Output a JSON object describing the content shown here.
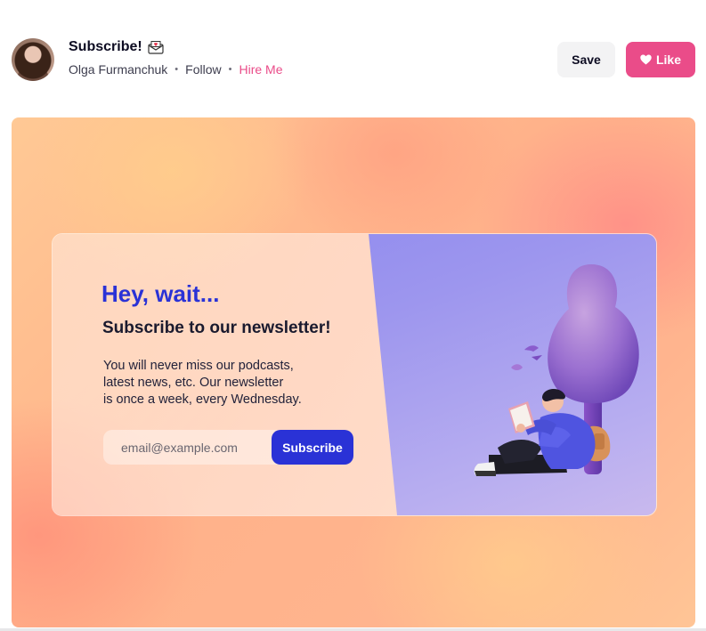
{
  "header": {
    "title": "Subscribe!",
    "title_icon": "envelope-icon",
    "author": "Olga Furmanchuk",
    "follow": "Follow",
    "hire": "Hire Me",
    "separator": "•",
    "save_label": "Save",
    "like_label": "Like",
    "like_icon": "heart-icon",
    "accent_color": "#ea4c89"
  },
  "shot": {
    "headline": "Hey, wait...",
    "subhead": "Subscribe to our newsletter!",
    "description_lines": [
      "You will never miss our podcasts,",
      "latest news, etc. Our newsletter",
      "is once a week, every Wednesday."
    ],
    "email_placeholder": "email@example.com",
    "subscribe_label": "Subscribe",
    "brand_color": "#2a32d6"
  }
}
